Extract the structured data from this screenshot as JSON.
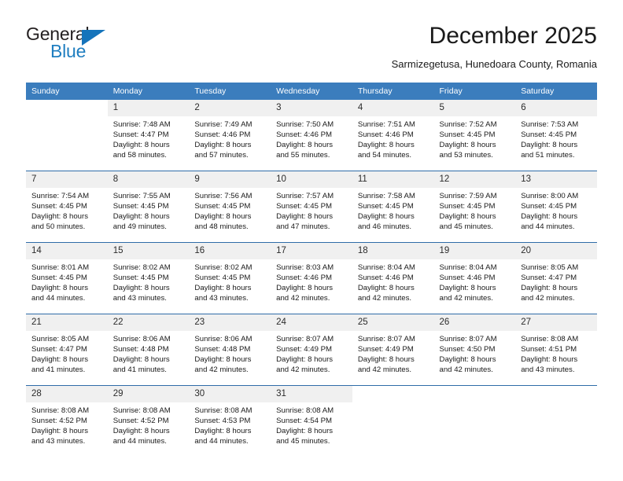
{
  "brand": {
    "name_top": "General",
    "name_bottom": "Blue",
    "accent_color": "#1f7ec0",
    "triangle_color": "#1574bb"
  },
  "header": {
    "title": "December 2025",
    "subtitle": "Sarmizegetusa, Hunedoara County, Romania"
  },
  "calendar": {
    "header_bg": "#3b7dbd",
    "header_text_color": "#ffffff",
    "daynum_bg": "#f0f0f0",
    "row_divider_color": "#2f6ca8",
    "weekdays": [
      "Sunday",
      "Monday",
      "Tuesday",
      "Wednesday",
      "Thursday",
      "Friday",
      "Saturday"
    ],
    "weeks": [
      [
        {
          "day": "",
          "lines": []
        },
        {
          "day": "1",
          "lines": [
            "Sunrise: 7:48 AM",
            "Sunset: 4:47 PM",
            "Daylight: 8 hours",
            "and 58 minutes."
          ]
        },
        {
          "day": "2",
          "lines": [
            "Sunrise: 7:49 AM",
            "Sunset: 4:46 PM",
            "Daylight: 8 hours",
            "and 57 minutes."
          ]
        },
        {
          "day": "3",
          "lines": [
            "Sunrise: 7:50 AM",
            "Sunset: 4:46 PM",
            "Daylight: 8 hours",
            "and 55 minutes."
          ]
        },
        {
          "day": "4",
          "lines": [
            "Sunrise: 7:51 AM",
            "Sunset: 4:46 PM",
            "Daylight: 8 hours",
            "and 54 minutes."
          ]
        },
        {
          "day": "5",
          "lines": [
            "Sunrise: 7:52 AM",
            "Sunset: 4:45 PM",
            "Daylight: 8 hours",
            "and 53 minutes."
          ]
        },
        {
          "day": "6",
          "lines": [
            "Sunrise: 7:53 AM",
            "Sunset: 4:45 PM",
            "Daylight: 8 hours",
            "and 51 minutes."
          ]
        }
      ],
      [
        {
          "day": "7",
          "lines": [
            "Sunrise: 7:54 AM",
            "Sunset: 4:45 PM",
            "Daylight: 8 hours",
            "and 50 minutes."
          ]
        },
        {
          "day": "8",
          "lines": [
            "Sunrise: 7:55 AM",
            "Sunset: 4:45 PM",
            "Daylight: 8 hours",
            "and 49 minutes."
          ]
        },
        {
          "day": "9",
          "lines": [
            "Sunrise: 7:56 AM",
            "Sunset: 4:45 PM",
            "Daylight: 8 hours",
            "and 48 minutes."
          ]
        },
        {
          "day": "10",
          "lines": [
            "Sunrise: 7:57 AM",
            "Sunset: 4:45 PM",
            "Daylight: 8 hours",
            "and 47 minutes."
          ]
        },
        {
          "day": "11",
          "lines": [
            "Sunrise: 7:58 AM",
            "Sunset: 4:45 PM",
            "Daylight: 8 hours",
            "and 46 minutes."
          ]
        },
        {
          "day": "12",
          "lines": [
            "Sunrise: 7:59 AM",
            "Sunset: 4:45 PM",
            "Daylight: 8 hours",
            "and 45 minutes."
          ]
        },
        {
          "day": "13",
          "lines": [
            "Sunrise: 8:00 AM",
            "Sunset: 4:45 PM",
            "Daylight: 8 hours",
            "and 44 minutes."
          ]
        }
      ],
      [
        {
          "day": "14",
          "lines": [
            "Sunrise: 8:01 AM",
            "Sunset: 4:45 PM",
            "Daylight: 8 hours",
            "and 44 minutes."
          ]
        },
        {
          "day": "15",
          "lines": [
            "Sunrise: 8:02 AM",
            "Sunset: 4:45 PM",
            "Daylight: 8 hours",
            "and 43 minutes."
          ]
        },
        {
          "day": "16",
          "lines": [
            "Sunrise: 8:02 AM",
            "Sunset: 4:45 PM",
            "Daylight: 8 hours",
            "and 43 minutes."
          ]
        },
        {
          "day": "17",
          "lines": [
            "Sunrise: 8:03 AM",
            "Sunset: 4:46 PM",
            "Daylight: 8 hours",
            "and 42 minutes."
          ]
        },
        {
          "day": "18",
          "lines": [
            "Sunrise: 8:04 AM",
            "Sunset: 4:46 PM",
            "Daylight: 8 hours",
            "and 42 minutes."
          ]
        },
        {
          "day": "19",
          "lines": [
            "Sunrise: 8:04 AM",
            "Sunset: 4:46 PM",
            "Daylight: 8 hours",
            "and 42 minutes."
          ]
        },
        {
          "day": "20",
          "lines": [
            "Sunrise: 8:05 AM",
            "Sunset: 4:47 PM",
            "Daylight: 8 hours",
            "and 42 minutes."
          ]
        }
      ],
      [
        {
          "day": "21",
          "lines": [
            "Sunrise: 8:05 AM",
            "Sunset: 4:47 PM",
            "Daylight: 8 hours",
            "and 41 minutes."
          ]
        },
        {
          "day": "22",
          "lines": [
            "Sunrise: 8:06 AM",
            "Sunset: 4:48 PM",
            "Daylight: 8 hours",
            "and 41 minutes."
          ]
        },
        {
          "day": "23",
          "lines": [
            "Sunrise: 8:06 AM",
            "Sunset: 4:48 PM",
            "Daylight: 8 hours",
            "and 42 minutes."
          ]
        },
        {
          "day": "24",
          "lines": [
            "Sunrise: 8:07 AM",
            "Sunset: 4:49 PM",
            "Daylight: 8 hours",
            "and 42 minutes."
          ]
        },
        {
          "day": "25",
          "lines": [
            "Sunrise: 8:07 AM",
            "Sunset: 4:49 PM",
            "Daylight: 8 hours",
            "and 42 minutes."
          ]
        },
        {
          "day": "26",
          "lines": [
            "Sunrise: 8:07 AM",
            "Sunset: 4:50 PM",
            "Daylight: 8 hours",
            "and 42 minutes."
          ]
        },
        {
          "day": "27",
          "lines": [
            "Sunrise: 8:08 AM",
            "Sunset: 4:51 PM",
            "Daylight: 8 hours",
            "and 43 minutes."
          ]
        }
      ],
      [
        {
          "day": "28",
          "lines": [
            "Sunrise: 8:08 AM",
            "Sunset: 4:52 PM",
            "Daylight: 8 hours",
            "and 43 minutes."
          ]
        },
        {
          "day": "29",
          "lines": [
            "Sunrise: 8:08 AM",
            "Sunset: 4:52 PM",
            "Daylight: 8 hours",
            "and 44 minutes."
          ]
        },
        {
          "day": "30",
          "lines": [
            "Sunrise: 8:08 AM",
            "Sunset: 4:53 PM",
            "Daylight: 8 hours",
            "and 44 minutes."
          ]
        },
        {
          "day": "31",
          "lines": [
            "Sunrise: 8:08 AM",
            "Sunset: 4:54 PM",
            "Daylight: 8 hours",
            "and 45 minutes."
          ]
        },
        {
          "day": "",
          "lines": []
        },
        {
          "day": "",
          "lines": []
        },
        {
          "day": "",
          "lines": []
        }
      ]
    ]
  }
}
